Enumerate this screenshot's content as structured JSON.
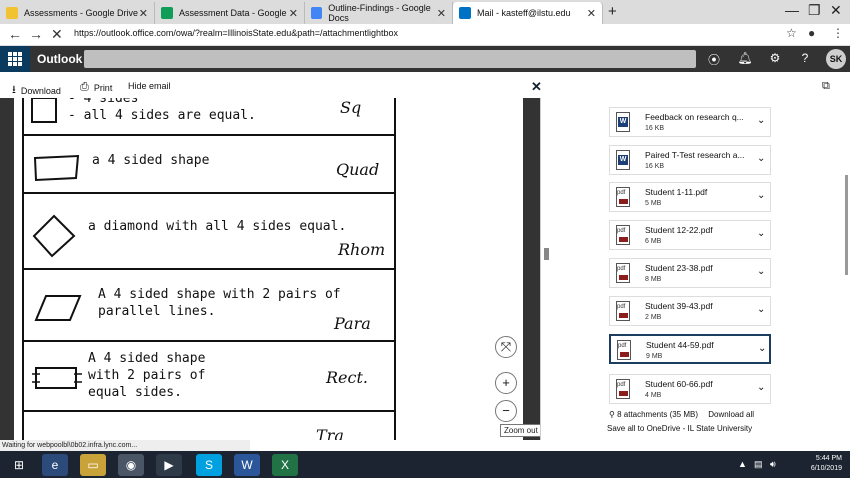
{
  "browser": {
    "tabs": [
      {
        "label": "Assessments - Google Drive",
        "color": "#f1c232"
      },
      {
        "label": "Assessment Data - Google Sheets",
        "color": "#0f9d58"
      },
      {
        "label": "Outline-Findings - Google Docs",
        "color": "#4285f4"
      },
      {
        "label": "Mail - kasteff@ilstu.edu",
        "color": "#0072c6"
      }
    ],
    "url": "https://outlook.office.com/owa/?realm=IllinoisState.edu&path=/attachmentlightbox"
  },
  "outlook": {
    "brand": "Outlook",
    "avatar_initials": "SK"
  },
  "actions": {
    "download": "Download",
    "print": "Print",
    "hide_email": "Hide email"
  },
  "document": {
    "rows": [
      {
        "desc": "- 4 sides\n- all 4 sides are equal.",
        "abbr": "Sq"
      },
      {
        "desc": "a 4 sided shape",
        "abbr": "Quad"
      },
      {
        "desc": "a diamond with all 4 sides equal.",
        "abbr": "Rhom"
      },
      {
        "desc": "A 4 sided shape with 2 pairs of\nparallel lines.",
        "abbr": "Para"
      },
      {
        "desc": "A 4 sided shape\nwith 2 pairs of\nequal sides.",
        "abbr": "Rect."
      },
      {
        "desc": "",
        "abbr": "Tra"
      }
    ],
    "zoom_tooltip": "Zoom out"
  },
  "attachments": {
    "items": [
      {
        "name": "Feedback on research q...",
        "size": "16 KB",
        "type": "word"
      },
      {
        "name": "Paired T-Test research a...",
        "size": "16 KB",
        "type": "word"
      },
      {
        "name": "Student 1-11.pdf",
        "size": "5 MB",
        "type": "pdf"
      },
      {
        "name": "Student 12-22.pdf",
        "size": "6 MB",
        "type": "pdf"
      },
      {
        "name": "Student 23-38.pdf",
        "size": "8 MB",
        "type": "pdf"
      },
      {
        "name": "Student 39-43.pdf",
        "size": "2 MB",
        "type": "pdf"
      },
      {
        "name": "Student 44-59.pdf",
        "size": "9 MB",
        "type": "pdf",
        "selected": true
      },
      {
        "name": "Student 60-66.pdf",
        "size": "4 MB",
        "type": "pdf"
      }
    ],
    "summary": "8 attachments (35 MB)",
    "download_all": "Download all",
    "save_all": "Save all to OneDrive - IL State University"
  },
  "status": "Waiting for webpoolbl\\0b02.infra.lync.com...",
  "taskbar": {
    "time": "5:44 PM",
    "date": "6/10/2019"
  }
}
